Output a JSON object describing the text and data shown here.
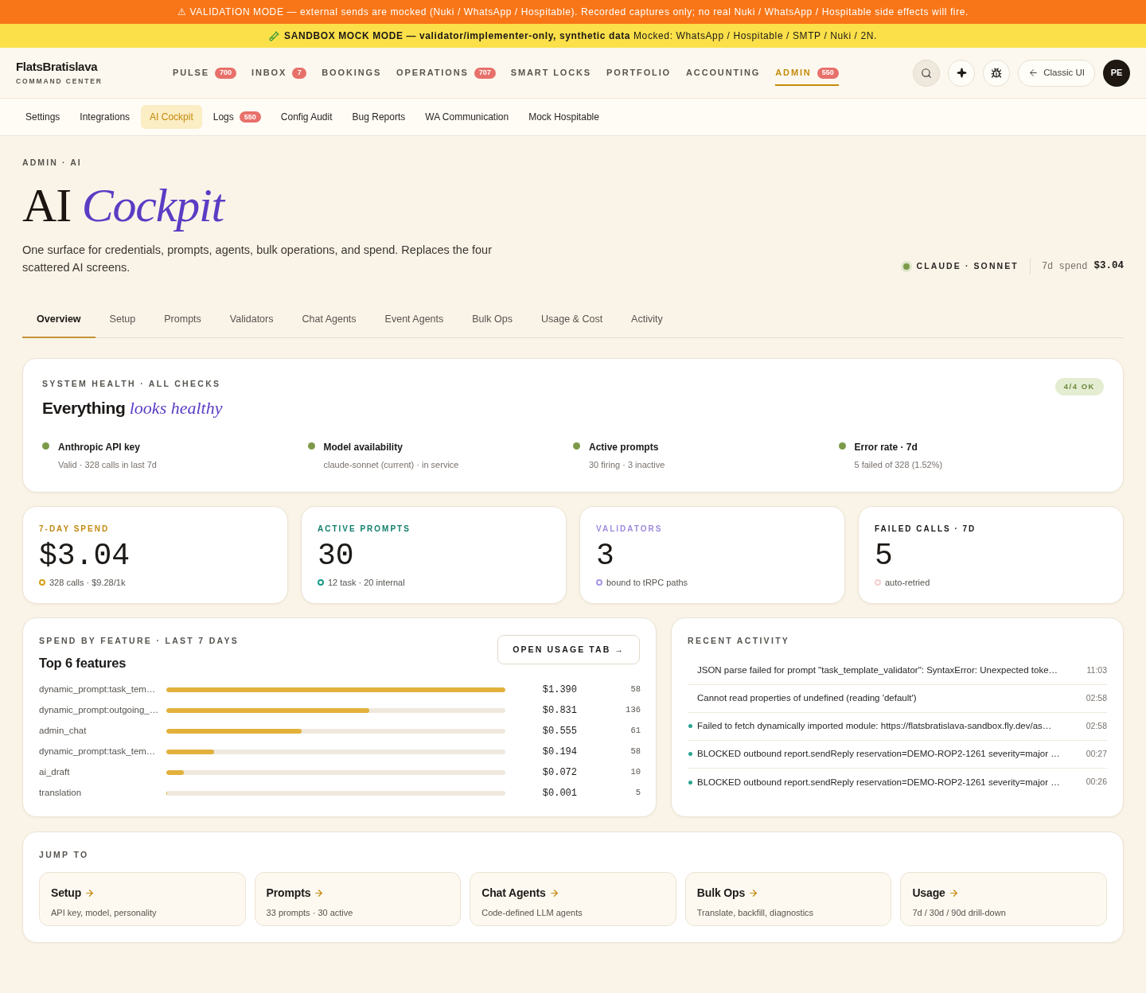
{
  "banners": [
    {
      "kind": "validation",
      "text": "⚠ VALIDATION MODE — external sends are mocked (Nuki / WhatsApp / Hospitable). Recorded captures only; no real Nuki / WhatsApp / Hospitable side effects will fire."
    },
    {
      "kind": "sandbox",
      "text": "**SANDBOX MOCK MODE — validator/implementer-only, synthetic data** Mocked: WhatsApp / Hospitable / SMTP / Nuki / 2N."
    }
  ],
  "brand": {
    "name": "FlatsBratislava",
    "tagline": "COMMAND CENTER"
  },
  "nav": [
    {
      "label": "PULSE",
      "badge": "700",
      "selected": false
    },
    {
      "label": "INBOX",
      "badge": "7",
      "selected": false
    },
    {
      "label": "BOOKINGS",
      "selected": false
    },
    {
      "label": "OPERATIONS",
      "badge": "707",
      "selected": false
    },
    {
      "label": "SMART LOCKS",
      "selected": false
    },
    {
      "label": "PORTFOLIO",
      "selected": false
    },
    {
      "label": "ACCOUNTING",
      "selected": false
    },
    {
      "label": "ADMIN",
      "badge": "550",
      "selected": true
    }
  ],
  "toolbar": {
    "classic_ui": "Classic UI",
    "avatar": "PE"
  },
  "subnav": [
    {
      "label": "Settings",
      "selected": false
    },
    {
      "label": "Integrations",
      "selected": false
    },
    {
      "label": "AI Cockpit",
      "selected": true
    },
    {
      "label": "Logs",
      "badge": "550",
      "selected": false
    },
    {
      "label": "Config Audit",
      "selected": false
    },
    {
      "label": "Bug Reports",
      "selected": false
    },
    {
      "label": "WA Communication",
      "selected": false
    },
    {
      "label": "Mock Hospitable",
      "selected": false
    }
  ],
  "page": {
    "breadcrumb": "ADMIN · AI",
    "title": "AI *Cockpit*",
    "description": "One surface for credentials, prompts, agents, bulk operations, and spend. Replaces the four scattered AI screens.",
    "model": "CLAUDE · SONNET",
    "spend_label": "7d spend",
    "spend_value": "$3.04"
  },
  "tabs": [
    {
      "label": "Overview",
      "selected": true
    },
    {
      "label": "Setup",
      "selected": false
    },
    {
      "label": "Prompts",
      "selected": false
    },
    {
      "label": "Validators",
      "selected": false
    },
    {
      "label": "Chat Agents",
      "selected": false
    },
    {
      "label": "Event Agents",
      "selected": false
    },
    {
      "label": "Bulk Ops",
      "selected": false
    },
    {
      "label": "Usage & Cost",
      "selected": false
    },
    {
      "label": "Activity",
      "selected": false
    }
  ],
  "health": {
    "eyebrow": "SYSTEM HEALTH · ALL CHECKS",
    "title": "Everything *looks healthy*",
    "badge": "4/4 OK",
    "checks": [
      {
        "title": "Anthropic API key",
        "detail": "Valid · 328 calls in last 7d",
        "ok": true
      },
      {
        "title": "Model availability",
        "detail": "claude-sonnet (current) · in service",
        "ok": true
      },
      {
        "title": "Active prompts",
        "detail": "30 firing · 3 inactive",
        "ok": true
      },
      {
        "title": "Error rate · 7d",
        "detail": "5 failed of 328 (1.52%)",
        "ok": true
      }
    ]
  },
  "stats": [
    {
      "label": "7-DAY SPEND",
      "color": "#c08a12",
      "value": "$3.04",
      "note": "328 calls · $9.28/1k",
      "dot": {
        "color": "#d4a017"
      }
    },
    {
      "label": "ACTIVE PROMPTS",
      "color": "#0f7f6c",
      "value": "30",
      "note": "12 task · 20 internal",
      "dot": {
        "color": "#1a9c88"
      }
    },
    {
      "label": "VALIDATORS",
      "color": "#9f8bdc",
      "value": "3",
      "note": "bound to tRPC paths",
      "dot": {
        "color": "#a995e6"
      }
    },
    {
      "label": "FAILED CALLS · 7D",
      "color": "#1c1917",
      "value": "5",
      "note": "auto-retried",
      "dot": {
        "color": "#f6d0d0"
      }
    }
  ],
  "spend": {
    "eyebrow": "SPEND BY FEATURE · LAST 7 DAYS",
    "title": "Top 6 features",
    "button": "OPEN USAGE TAB →",
    "rows": [
      {
        "feature": "dynamic_prompt:task_tem…",
        "level": 1,
        "cost": "$1.390",
        "calls": "58"
      },
      {
        "feature": "dynamic_prompt:outgoing_…",
        "level": 0.598,
        "cost": "$0.831",
        "calls": "136"
      },
      {
        "feature": "admin_chat",
        "level": 0.4,
        "cost": "$0.555",
        "calls": "61"
      },
      {
        "feature": "dynamic_prompt:task_tem…",
        "level": 0.14,
        "cost": "$0.194",
        "calls": "58"
      },
      {
        "feature": "ai_draft",
        "level": 0.052,
        "cost": "$0.072",
        "calls": "10"
      },
      {
        "feature": "translation",
        "level": 0.003,
        "cost": "$0.001",
        "calls": "5"
      }
    ]
  },
  "activity": {
    "eyebrow": "RECENT ACTIVITY",
    "rows": [
      {
        "text": "JSON parse failed for prompt \"task_template_validator\": SyntaxError: Unexpected toke…",
        "time": "11:03",
        "dot": false
      },
      {
        "text": "Cannot read properties of undefined (reading 'default')",
        "time": "02:58",
        "dot": false
      },
      {
        "text": "Failed to fetch dynamically imported module: https://flatsbratislava-sandbox.fly.dev/as…",
        "time": "02:58",
        "dot": true
      },
      {
        "text": "BLOCKED outbound report.sendReply reservation=DEMO-ROP2-1261 severity=major …",
        "time": "00:27",
        "dot": true
      },
      {
        "text": "BLOCKED outbound report.sendReply reservation=DEMO-ROP2-1261 severity=major …",
        "time": "00:26",
        "dot": true
      }
    ]
  },
  "jump": {
    "eyebrow": "JUMP TO",
    "tiles": [
      {
        "title": "Setup",
        "detail": "API key, model, personality"
      },
      {
        "title": "Prompts",
        "detail": "33 prompts · 30 active"
      },
      {
        "title": "Chat Agents",
        "detail": "Code-defined LLM agents"
      },
      {
        "title": "Bulk Ops",
        "detail": "Translate, backfill, diagnostics"
      },
      {
        "title": "Usage",
        "detail": "7d / 30d / 90d drill-down"
      }
    ]
  }
}
